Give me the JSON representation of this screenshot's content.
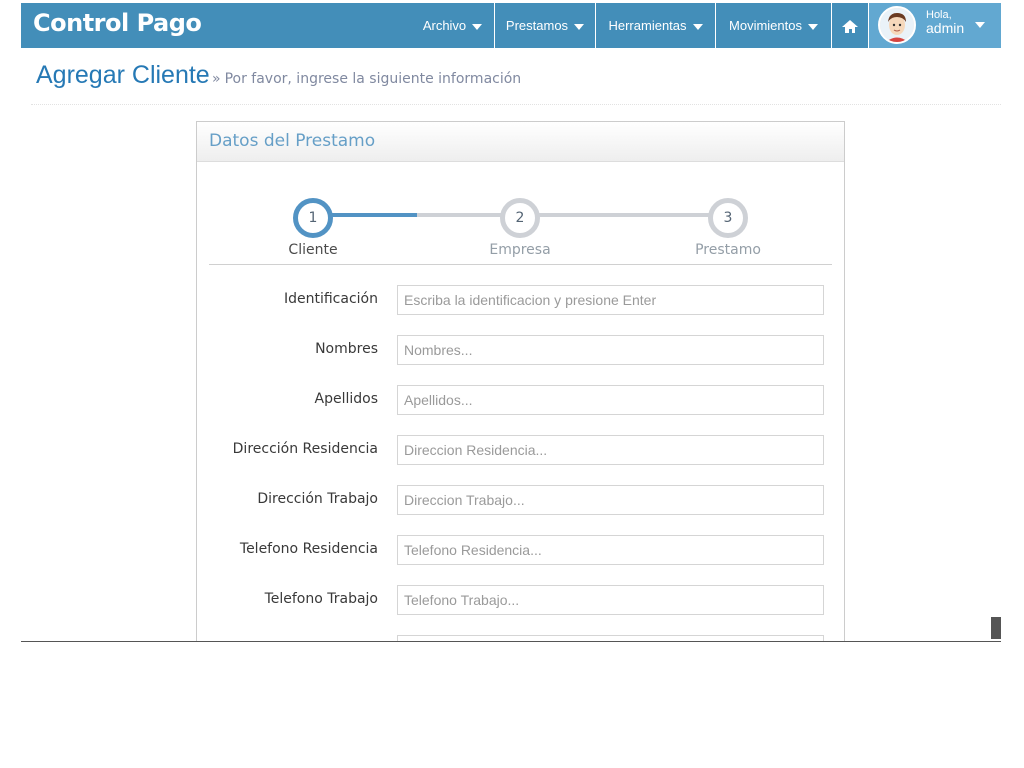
{
  "navbar": {
    "brand": "Control Pago",
    "menus": [
      {
        "label": "Archivo"
      },
      {
        "label": "Prestamos"
      },
      {
        "label": "Herramientas"
      },
      {
        "label": "Movimientos"
      }
    ],
    "user": {
      "greeting": "Hola,",
      "name": "admin"
    }
  },
  "page": {
    "title": "Agregar Cliente",
    "subtitle_marker": "»",
    "subtitle": "Por favor, ingrese la siguiente información"
  },
  "widget": {
    "title": "Datos del Prestamo",
    "steps": [
      {
        "number": "1",
        "label": "Cliente",
        "active": true
      },
      {
        "number": "2",
        "label": "Empresa",
        "active": false
      },
      {
        "number": "3",
        "label": "Prestamo",
        "active": false
      }
    ]
  },
  "form": {
    "fields": [
      {
        "label": "Identificación",
        "placeholder": "Escriba la identificacion y presione Enter",
        "value": ""
      },
      {
        "label": "Nombres",
        "placeholder": "Nombres...",
        "value": ""
      },
      {
        "label": "Apellidos",
        "placeholder": "Apellidos...",
        "value": ""
      },
      {
        "label": "Dirección Residencia",
        "placeholder": "Direccion Residencia...",
        "value": ""
      },
      {
        "label": "Dirección Trabajo",
        "placeholder": "Direccion Trabajo...",
        "value": ""
      },
      {
        "label": "Telefono Residencia",
        "placeholder": "Telefono Residencia...",
        "value": ""
      },
      {
        "label": "Telefono Trabajo",
        "placeholder": "Telefono Trabajo...",
        "value": ""
      }
    ]
  },
  "colors": {
    "navbar": "#438eb9",
    "accent": "#5293c4",
    "title": "#2679b5"
  }
}
